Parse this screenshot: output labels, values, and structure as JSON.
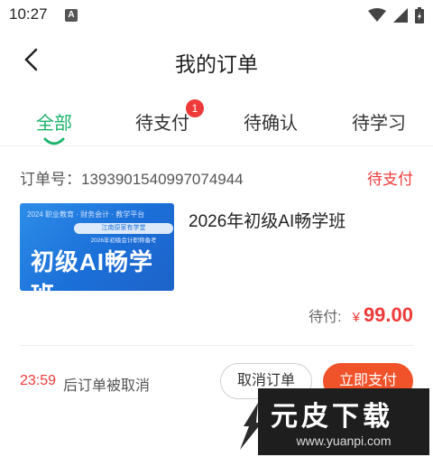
{
  "status_bar": {
    "time": "10:27",
    "notif_letter": "A"
  },
  "header": {
    "title": "我的订单"
  },
  "tabs": [
    {
      "label": "全部",
      "active": true
    },
    {
      "label": "待支付",
      "badge": "1"
    },
    {
      "label": "待确认"
    },
    {
      "label": "待学习"
    }
  ],
  "order": {
    "number_label": "订单号：1393901540997074944",
    "status": "待支付",
    "thumb": {
      "top_text": "2024 职业教育 · 财务会计 · 教学平台",
      "ribbon": "江南原家有学堂",
      "subtext": "2026年初级会计职称备考",
      "title": "初级AI畅学班"
    },
    "course_name": "2026年初级AI畅学班",
    "price_label": "待付:",
    "currency": "¥",
    "price": "99.00",
    "countdown": "23:59",
    "cancel_note": "后订单被取消",
    "cancel_button": "取消订单",
    "pay_button": "立即支付"
  },
  "watermark": {
    "logo": "元皮下载",
    "url": "www.yuanpi.com"
  },
  "colors": {
    "accent": "#1db36b",
    "danger": "#ef3a3a",
    "pay": "#f0522a"
  }
}
